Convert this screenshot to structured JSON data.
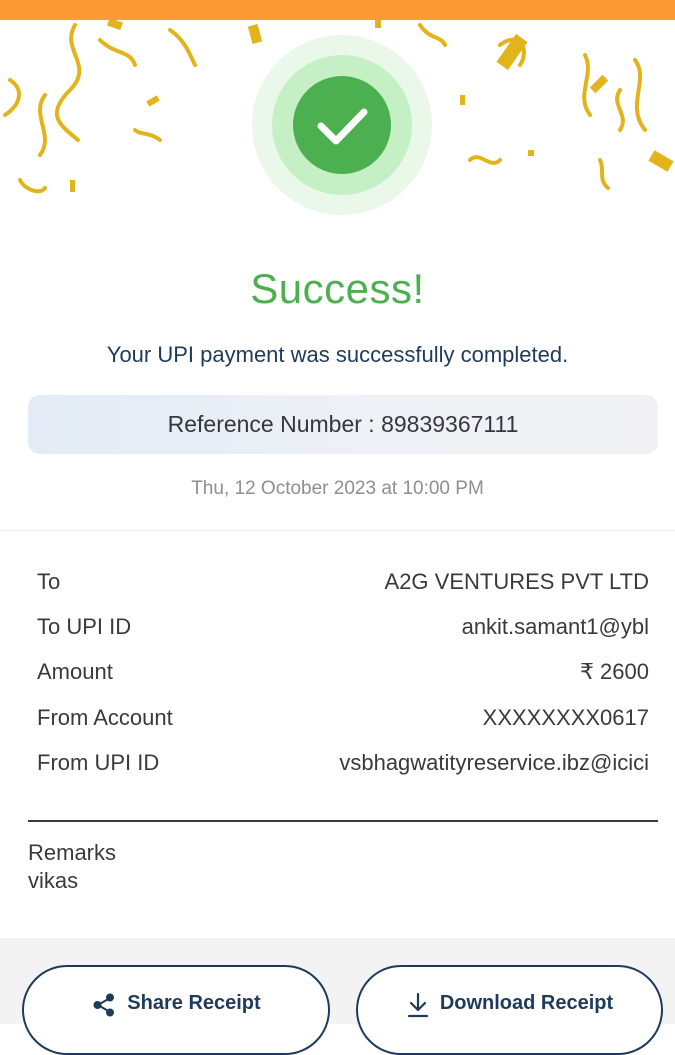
{
  "colors": {
    "top_bar": "#FD9A33",
    "success_green": "#4CAF50",
    "navy": "#1E3B5C",
    "confetti_gold": "#E3B31C"
  },
  "status": {
    "title": "Success!",
    "message": "Your UPI payment was successfully completed.",
    "icon": "check-icon"
  },
  "reference": {
    "text": "Reference Number : 89839367111"
  },
  "timestamp": "Thu, 12 October 2023 at 10:00 PM",
  "details": [
    {
      "label": "To",
      "value": "A2G VENTURES PVT LTD"
    },
    {
      "label": "To UPI ID",
      "value": "ankit.samant1@ybl"
    },
    {
      "label": "Amount",
      "value": "₹ 2600"
    },
    {
      "label": "From Account",
      "value": "XXXXXXXX0617"
    },
    {
      "label": "From UPI ID",
      "value": "vsbhagwatityreservice.ibz@icici"
    }
  ],
  "remarks": {
    "label": "Remarks",
    "value": "vikas"
  },
  "actions": {
    "share_label": "Share Receipt",
    "share_icon": "share-icon",
    "download_label": "Download Receipt",
    "download_icon": "download-icon"
  }
}
